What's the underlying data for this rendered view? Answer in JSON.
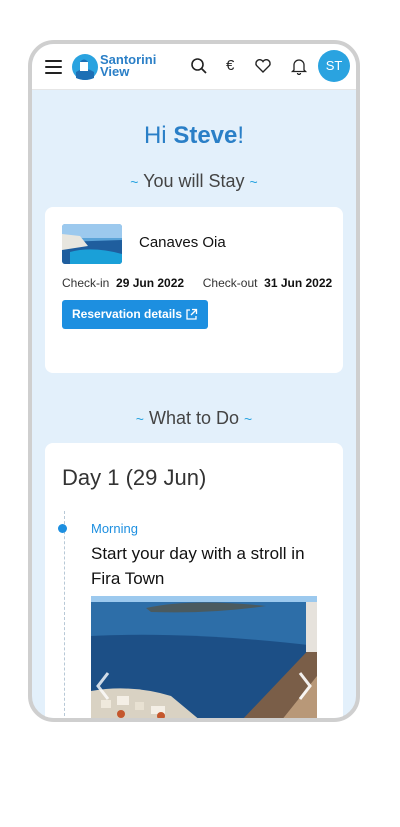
{
  "brand": {
    "line1": "Santorini",
    "line2": "View"
  },
  "header": {
    "currency_symbol": "€",
    "avatar_initials": "ST"
  },
  "greeting": {
    "prefix": "Hi ",
    "name": "Steve",
    "suffix": "!"
  },
  "stay": {
    "title": "You will Stay",
    "hotel_name": "Canaves Oia",
    "checkin_label": "Check-in",
    "checkin_date": "29 Jun 2022",
    "checkout_label": "Check-out",
    "checkout_date": "31 Jun 2022",
    "button_label": "Reservation details"
  },
  "todo": {
    "title": "What to Do",
    "day_label": "Day 1 (29 Jun)",
    "slot": "Morning",
    "activity": "Start your day with a stroll in Fira Town"
  },
  "decor": {
    "tilde": "~"
  },
  "colors": {
    "accent": "#1d8fe0",
    "brand": "#2a7fc7",
    "background": "#e3f0fb"
  }
}
